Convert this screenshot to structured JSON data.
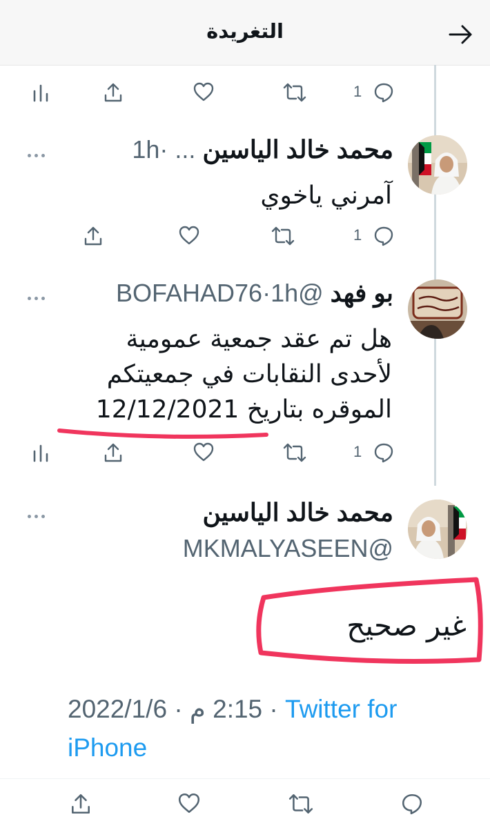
{
  "header": {
    "title": "التغريدة",
    "back_icon": "arrow-right-icon"
  },
  "colors": {
    "link": "#1d9bf0",
    "secondary": "#536471",
    "annotation": "#f0355d"
  },
  "top_actions": {
    "reply_count": "1"
  },
  "tweets": [
    {
      "name": "محمد خالد الياسين",
      "name_ellipsis": "...",
      "time": "1h",
      "text_lines": [
        "آمرني ياخوي"
      ],
      "reply_count": "1"
    },
    {
      "name": "بو فهد",
      "handle": "@BOFAHAD76",
      "time": "1h",
      "text_lines": [
        "هل تم عقد جمعية عمومية",
        "لأحدى النقابات في جمعيتكم",
        "الموقره بتاريخ 12/12/2021"
      ],
      "reply_count": "1"
    }
  ],
  "main_tweet": {
    "name": "محمد خالد الياسين",
    "handle": "@MKMALYASEEN",
    "text": "غير صحيح",
    "date": "2022/1/6",
    "time": "2:15 م",
    "source": "Twitter for iPhone"
  }
}
